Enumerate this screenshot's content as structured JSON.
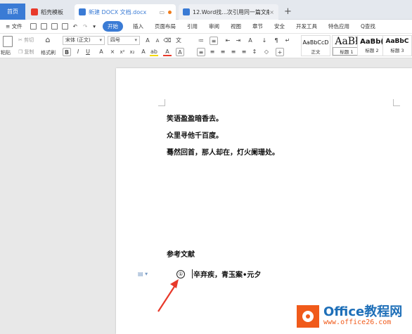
{
  "tabs": {
    "home": "首页",
    "templates": "稻壳模板",
    "active_doc": "新建 DOCX 文档.docx",
    "other_doc": "12.Word找...次引用同一篇文献"
  },
  "menu": {
    "file": "文件",
    "items": [
      "开始",
      "插入",
      "页面布局",
      "引用",
      "审阅",
      "视图",
      "章节",
      "安全",
      "开发工具",
      "特色应用"
    ],
    "search": "Q查找"
  },
  "ribbon": {
    "paste": "粘贴",
    "cut": "剪切",
    "copy": "复制",
    "format_painter": "格式刷",
    "font_name": "宋体 (正文)",
    "font_size": "四号",
    "styles": [
      {
        "preview": "AaBbCcD",
        "name": "正文"
      },
      {
        "preview": "AaBł",
        "name": "标题 1"
      },
      {
        "preview": "AaBb(",
        "name": "标题 2"
      },
      {
        "preview": "AaBbC",
        "name": "标题 3"
      }
    ]
  },
  "document": {
    "lines": [
      "笑语盈盈暗香去。",
      "众里寻他千百度。",
      "蓦然回首，那人却在，灯火阑珊处。"
    ],
    "ref_heading": "参考文献",
    "ref_number": "①",
    "ref_text": "辛弃疾，青玉案•元夕"
  },
  "watermark": {
    "line1": "Office教程网",
    "line2": "www.office26.com"
  },
  "colors": {
    "accent": "#3a7bd5",
    "arrow": "#e8392a",
    "logo_blue": "#1e6fb8",
    "logo_orange": "#f05a1a"
  }
}
